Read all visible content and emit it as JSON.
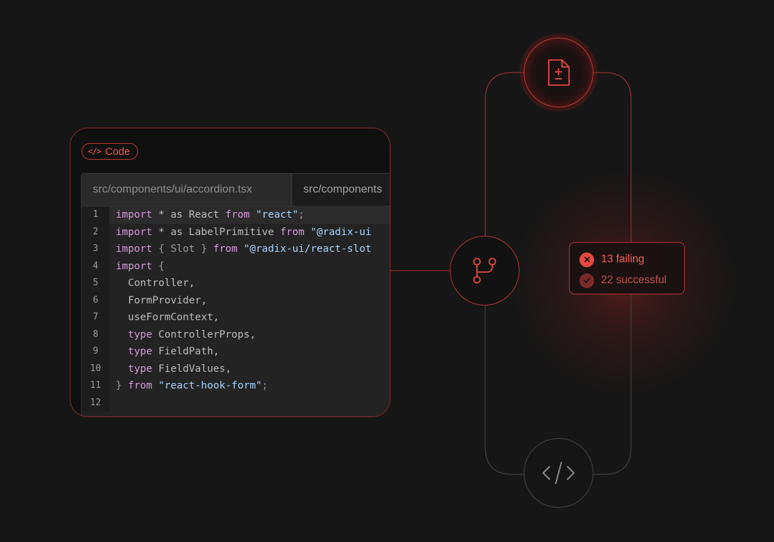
{
  "code_panel": {
    "badge_label": "Code",
    "tabs": [
      {
        "label": "src/components/ui/accordion.tsx"
      },
      {
        "label": "src/components"
      }
    ],
    "lines": [
      {
        "n": "1",
        "tokens": [
          [
            "kw",
            "import"
          ],
          [
            "id",
            " * as React "
          ],
          [
            "kw",
            "from"
          ],
          [
            "id",
            " "
          ],
          [
            "str",
            "\"react\""
          ],
          [
            "pn",
            ";"
          ]
        ]
      },
      {
        "n": "2",
        "tokens": [
          [
            "kw",
            "import"
          ],
          [
            "id",
            " * as LabelPrimitive "
          ],
          [
            "kw",
            "from"
          ],
          [
            "id",
            " "
          ],
          [
            "str",
            "\"@radix-ui"
          ]
        ]
      },
      {
        "n": "3",
        "tokens": [
          [
            "kw",
            "import"
          ],
          [
            "pn",
            " { Slot } "
          ],
          [
            "kw",
            "from"
          ],
          [
            "id",
            " "
          ],
          [
            "str",
            "\"@radix-ui/react-slot"
          ]
        ]
      },
      {
        "n": "4",
        "tokens": [
          [
            "kw",
            "import"
          ],
          [
            "pn",
            " {"
          ]
        ]
      },
      {
        "n": "5",
        "tokens": [
          [
            "id",
            "  Controller,"
          ]
        ]
      },
      {
        "n": "6",
        "tokens": [
          [
            "id",
            "  FormProvider,"
          ]
        ]
      },
      {
        "n": "7",
        "tokens": [
          [
            "id",
            "  useFormContext,"
          ]
        ]
      },
      {
        "n": "8",
        "tokens": [
          [
            "id",
            "  "
          ],
          [
            "kw",
            "type"
          ],
          [
            "id",
            " ControllerProps,"
          ]
        ]
      },
      {
        "n": "9",
        "tokens": [
          [
            "id",
            "  "
          ],
          [
            "kw",
            "type"
          ],
          [
            "id",
            " FieldPath,"
          ]
        ]
      },
      {
        "n": "10",
        "tokens": [
          [
            "id",
            "  "
          ],
          [
            "kw",
            "type"
          ],
          [
            "id",
            " FieldValues,"
          ]
        ]
      },
      {
        "n": "11",
        "tokens": [
          [
            "pn",
            "} "
          ],
          [
            "kw",
            "from"
          ],
          [
            "id",
            " "
          ],
          [
            "str",
            "\"react-hook-form\""
          ],
          [
            "pn",
            ";"
          ]
        ]
      },
      {
        "n": "12",
        "tokens": []
      }
    ]
  },
  "status": {
    "failing_label": "13 failing",
    "success_label": "22 successful"
  },
  "nodes": {
    "top": "file-diff-icon",
    "middle": "git-branch-icon",
    "bottom": "code-icon"
  },
  "colors": {
    "accent": "#e54a40",
    "background": "#161616"
  }
}
